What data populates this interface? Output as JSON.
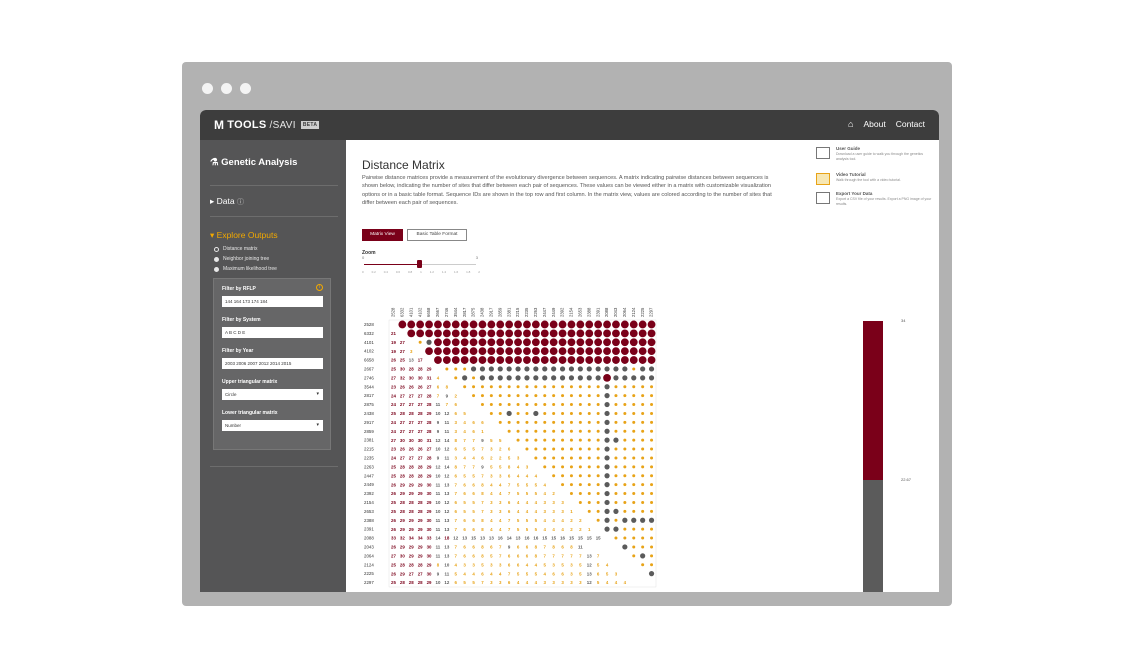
{
  "app": {
    "logo_main": "TOOLS",
    "logo_sub": "SAVI",
    "logo_badge": "BETA",
    "nav_about": "About",
    "nav_contact": "Contact"
  },
  "sidebar": {
    "section_title": "Genetic Analysis",
    "data_label": "Data",
    "explore_label": "Explore Outputs",
    "outputs": [
      "Distance matrix",
      "Neighbor joining tree",
      "Maximum likelihood tree"
    ],
    "filters": {
      "rflp_label": "Filter by RFLP",
      "rflp_value": "144  164  173  174  184",
      "system_label": "Filter by System",
      "system_value": "A  B  C  D  E",
      "year_label": "Filter by Year",
      "year_value": "2003  2006  2007  2012  2014  2015",
      "upper_label": "Upper triangular matrix",
      "upper_value": "Circle",
      "lower_label": "Lower triangular matrix",
      "lower_value": "Number"
    }
  },
  "main": {
    "title": "Distance Matrix",
    "description": "Pairwise distance matrices provide a measurement of the evolutionary divergence between sequences. A matrix indicating pairwise distances between sequences is shown below, indicating the number of sites that differ between each pair of sequences. These values can be viewed either in a matrix with customizable visualization options or in a basic table format. Sequence IDs are shown in the top row and first column. In the matrix view, values are colored according to the number of sites that differ between each pair of sequences.",
    "btn_matrix": "Matrix View",
    "btn_table": "Basic Table Format",
    "zoom_label": "Zoom",
    "zoom_min": "0",
    "zoom_max": "3",
    "zoom_value": 0.5,
    "zoom_ticks": [
      "0",
      "0.2",
      "0.4",
      "0.6",
      "0.8",
      "1",
      "1.2",
      "1.4",
      "1.6",
      "1.8",
      "2"
    ]
  },
  "resources": [
    {
      "title": "User Guide",
      "desc": "Download a user guide to walk you through the genetics analysis tool."
    },
    {
      "title": "Video Tutorial",
      "desc": "Walk through the tool with a video tutorial."
    },
    {
      "title": "Export Your Data",
      "desc": "Export a CSV file of your results. Export a PNG image of your results."
    }
  ],
  "colors": {
    "maroon": "#7a0019",
    "gray": "#5b5b5b",
    "gold": "#e8a317",
    "topbar": "#3d3d3d",
    "sidebar": "#555556"
  },
  "chart_data": {
    "type": "heatmap",
    "ids": [
      "2528",
      "6332",
      "4101",
      "4102",
      "6658",
      "2667",
      "2746",
      "3544",
      "2817",
      "2875",
      "2438",
      "2917",
      "2859",
      "2381",
      "2215",
      "2235",
      "2263",
      "2447",
      "2449",
      "2392",
      "2154",
      "2653",
      "2388",
      "2391",
      "2088",
      "2043",
      "2064",
      "2124",
      "2225",
      "2297"
    ],
    "row_first_values": [
      [],
      [
        21
      ],
      [
        19,
        27
      ],
      [
        19,
        27,
        3
      ],
      [
        26,
        25,
        13,
        17
      ],
      [
        25,
        30,
        28,
        28,
        29
      ],
      [
        27,
        32,
        30,
        30,
        31,
        4
      ],
      [
        23,
        26,
        26,
        26,
        27,
        6,
        8
      ],
      [
        24,
        27,
        27,
        27,
        28,
        7,
        9,
        2
      ],
      [
        24,
        27,
        27,
        27,
        28,
        11,
        7,
        6
      ],
      [
        25,
        28,
        28,
        28,
        29,
        10,
        12,
        6,
        5
      ],
      [
        24,
        27,
        27,
        27,
        28,
        9,
        11,
        3,
        4,
        6,
        6
      ],
      [
        24,
        27,
        27,
        27,
        28,
        9,
        11,
        3,
        4,
        6,
        1
      ],
      [
        27,
        30,
        30,
        30,
        31,
        12,
        14,
        8,
        7,
        7,
        9,
        5,
        5
      ],
      [
        23,
        26,
        26,
        26,
        27,
        10,
        12,
        6,
        5,
        5,
        7,
        3,
        2,
        6
      ],
      [
        24,
        27,
        27,
        27,
        28,
        9,
        11,
        3,
        4,
        4,
        6,
        2,
        2,
        5,
        3
      ],
      [
        25,
        28,
        28,
        28,
        29,
        12,
        14,
        8,
        7,
        7,
        9,
        5,
        5,
        8,
        4,
        3
      ],
      [
        25,
        28,
        28,
        28,
        29,
        10,
        12,
        6,
        5,
        5,
        7,
        3,
        3,
        6,
        4,
        4,
        4
      ],
      [
        26,
        29,
        29,
        29,
        30,
        11,
        13,
        7,
        6,
        6,
        8,
        4,
        4,
        7,
        5,
        5,
        5,
        4
      ],
      [
        26,
        29,
        29,
        29,
        30,
        11,
        13,
        7,
        6,
        6,
        8,
        4,
        4,
        7,
        5,
        5,
        5,
        4,
        2
      ],
      [
        25,
        28,
        28,
        28,
        29,
        10,
        12,
        6,
        5,
        5,
        7,
        3,
        3,
        6,
        4,
        4,
        4,
        3,
        3,
        3
      ],
      [
        25,
        28,
        28,
        28,
        29,
        10,
        12,
        6,
        5,
        5,
        7,
        3,
        3,
        6,
        4,
        4,
        4,
        3,
        3,
        3,
        1
      ],
      [
        26,
        29,
        29,
        29,
        30,
        11,
        13,
        7,
        6,
        6,
        8,
        4,
        4,
        7,
        5,
        5,
        5,
        4,
        4,
        4,
        2,
        2
      ],
      [
        26,
        29,
        29,
        29,
        30,
        11,
        13,
        7,
        6,
        6,
        8,
        4,
        4,
        7,
        5,
        5,
        5,
        4,
        4,
        4,
        2,
        2,
        1
      ],
      [
        33,
        32,
        34,
        34,
        33,
        14,
        18,
        12,
        13,
        15,
        13,
        13,
        16,
        14,
        13,
        16,
        16,
        15,
        15,
        16,
        15,
        15,
        15,
        15
      ],
      [
        26,
        29,
        29,
        29,
        30,
        11,
        13,
        7,
        6,
        6,
        8,
        6,
        7,
        9,
        6,
        6,
        8,
        7,
        8,
        6,
        8,
        11
      ],
      [
        27,
        30,
        29,
        29,
        30,
        11,
        13,
        7,
        6,
        6,
        8,
        5,
        7,
        6,
        6,
        6,
        8,
        7,
        7,
        7,
        7,
        7,
        13,
        7
      ],
      [
        25,
        28,
        28,
        28,
        29,
        8,
        10,
        4,
        3,
        3,
        5,
        3,
        3,
        6,
        6,
        4,
        4,
        5,
        3,
        5,
        3,
        5,
        12,
        5,
        4
      ],
      [
        26,
        29,
        27,
        27,
        30,
        9,
        11,
        5,
        4,
        4,
        6,
        4,
        4,
        7,
        5,
        5,
        5,
        4,
        6,
        6,
        3,
        5,
        13,
        6,
        5,
        3
      ],
      [
        25,
        28,
        28,
        28,
        29,
        10,
        12,
        6,
        5,
        5,
        7,
        3,
        3,
        6,
        4,
        4,
        4,
        3,
        3,
        3,
        3,
        3,
        12,
        5,
        4,
        4,
        4
      ]
    ],
    "legend_labels": [
      "34",
      "22.67"
    ],
    "upper_style": "circle",
    "lower_style": "number"
  }
}
